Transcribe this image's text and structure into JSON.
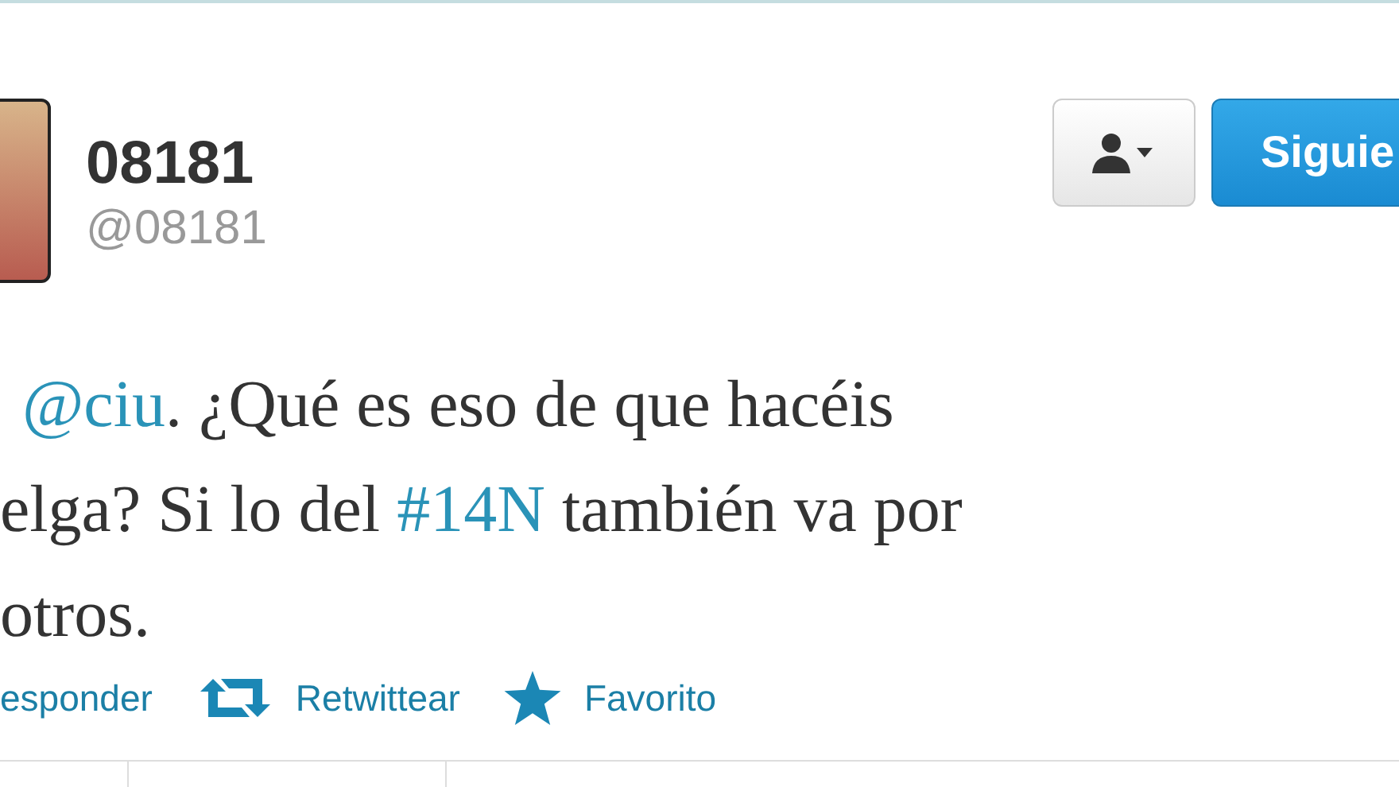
{
  "author": {
    "name": "08181",
    "handle": "@08181"
  },
  "buttons": {
    "follow": "Siguie"
  },
  "tweet_lines": [
    [
      {
        "kind": "link",
        "text": "@ciu"
      },
      {
        "kind": "text",
        "text": ". ¿Qué es eso de que hacéis"
      }
    ],
    [
      {
        "kind": "text",
        "text": "elga? Si lo del "
      },
      {
        "kind": "link",
        "text": "#14N"
      },
      {
        "kind": "text",
        "text": " también va por"
      }
    ],
    [
      {
        "kind": "text",
        "text": "otros."
      }
    ]
  ],
  "actions": [
    {
      "kind": "reply",
      "label": "esponder"
    },
    {
      "kind": "retweet",
      "label": "Retwittear"
    },
    {
      "kind": "favorite",
      "label": "Favorito"
    }
  ]
}
